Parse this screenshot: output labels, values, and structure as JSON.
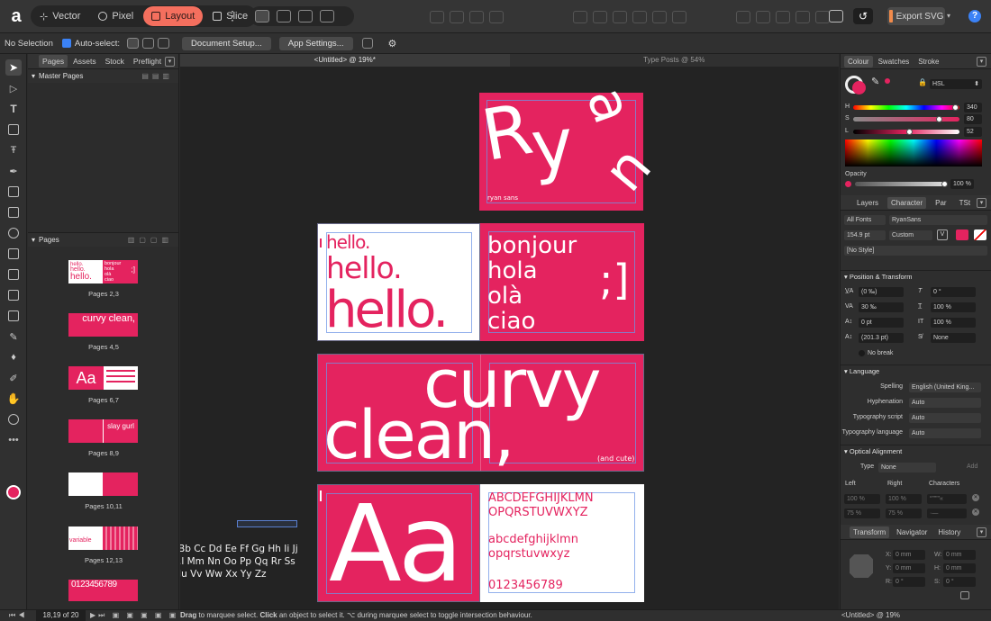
{
  "app": {
    "logo": "a"
  },
  "toolbar": {
    "personas": [
      {
        "label": "Vector",
        "active": false
      },
      {
        "label": "Pixel",
        "active": false
      },
      {
        "label": "Layout",
        "active": true
      },
      {
        "label": "Slice",
        "active": false
      }
    ],
    "more": "⋮",
    "export_label": "Export SVG",
    "help": "?"
  },
  "context": {
    "selection": "No Selection",
    "autoselect": "Auto-select:",
    "doc_setup": "Document Setup...",
    "app_settings": "App Settings..."
  },
  "left_panel": {
    "tabs": [
      "Pages",
      "Assets",
      "Stock",
      "Preflight"
    ],
    "master_header": "Master Pages",
    "pages_header": "Pages",
    "pages": [
      {
        "label": "Pages 2,3",
        "left": [
          "hello.",
          "hello.",
          "hello."
        ],
        "right": [
          "bonjour",
          "hola",
          "olà",
          "ciao"
        ],
        "mark": ";]"
      },
      {
        "label": "Pages 4,5",
        "text": "curvy clean,"
      },
      {
        "label": "Pages 6,7",
        "text": "Aa"
      },
      {
        "label": "Pages 8,9",
        "text": "slay gurl"
      },
      {
        "label": "Pages 10,11"
      },
      {
        "label": "Pages 12,13",
        "text": "variable"
      },
      {
        "text": "0123456789"
      }
    ],
    "page_counter": "18,19 of 20"
  },
  "canvas": {
    "doc_tabs": [
      "<Untitled> @ 19%*",
      "Type Posts @ 54%"
    ],
    "cover": {
      "title_letters": [
        "R",
        "y",
        "a",
        "n"
      ],
      "caption": "ryan sans"
    },
    "greeting": {
      "hello": [
        "hello.",
        "hello.",
        "hello."
      ],
      "words": [
        "bonjour",
        "hola",
        "olà",
        "ciao"
      ],
      "mark": ";]"
    },
    "curvy": {
      "line1": "curvy",
      "line2": "clean,",
      "caption": "(and cute)"
    },
    "specimen": {
      "big": "Aa",
      "upper1": "ABCDEFGHIJKLMN",
      "upper2": "OPQRSTUVWXYZ",
      "lower1": "abcdefghijklmn",
      "lower2": "opqrstuvwxyz",
      "digits": "0123456789"
    },
    "pasteboard": [
      "Bb Cc Dd Ee Ff Gg Hh Ii Jj",
      ".l Mm Nn Oo Pp Qq Rr Ss",
      "Ju Vv Ww Xx Yy Zz"
    ]
  },
  "colour_panel": {
    "tabs": [
      "Colour",
      "Swatches",
      "Stroke"
    ],
    "model": "HSL",
    "h": {
      "label": "H",
      "value": "340"
    },
    "s": {
      "label": "S",
      "value": "80"
    },
    "l": {
      "label": "L",
      "value": "52"
    },
    "opacity_label": "Opacity",
    "opacity_value": "100 %",
    "accent": "#e4235f"
  },
  "char_panel": {
    "tabs": [
      "Layers",
      "Character",
      "Par",
      "TSt"
    ],
    "font_collection": "All Fonts",
    "font_name": "RyanSans",
    "font_size": "154.9 pt",
    "size_mode": "Custom",
    "style": "[No Style]",
    "pos_header": "Position & Transform",
    "kerning": "(0 ‰)",
    "baseline_shift": "0 °",
    "tracking": "30 ‰",
    "h_scale": "100 %",
    "baseline": "0 pt",
    "v_scale": "100 %",
    "leading": "(201.3 pt)",
    "shear": "None",
    "no_break": "No break",
    "lang_header": "Language",
    "spelling_label": "Spelling",
    "spelling": "English (United King...",
    "hyph_label": "Hyphenation",
    "hyph": "Auto",
    "script_label": "Typography script",
    "script": "Auto",
    "lang_label": "Typography language",
    "lang": "Auto",
    "optical_header": "Optical Alignment",
    "type_label": "Type",
    "type": "None",
    "add": "Add",
    "cols": [
      "Left",
      "Right",
      "Characters"
    ],
    "row1": [
      "100 %",
      "100 %",
      "“”'\"\"«"
    ],
    "row2": [
      "75 %",
      "75 %",
      "·—"
    ]
  },
  "transform_panel": {
    "tabs": [
      "Transform",
      "Navigator",
      "History"
    ],
    "x": "X:",
    "x_val": "0 mm",
    "y": "Y:",
    "y_val": "0 mm",
    "w": "W:",
    "w_val": "0 mm",
    "h": "H:",
    "h_val": "0 mm",
    "r": "R:",
    "r_val": "0 °",
    "s": "S:",
    "s_val": "0 °"
  },
  "status": {
    "drag": "Drag",
    "text1": " to marquee select. ",
    "click": "Click",
    "text2": " an object to select it. ",
    "text3": " during marquee select to toggle intersection behaviour.",
    "right": "<Untitled> @ 19%"
  }
}
